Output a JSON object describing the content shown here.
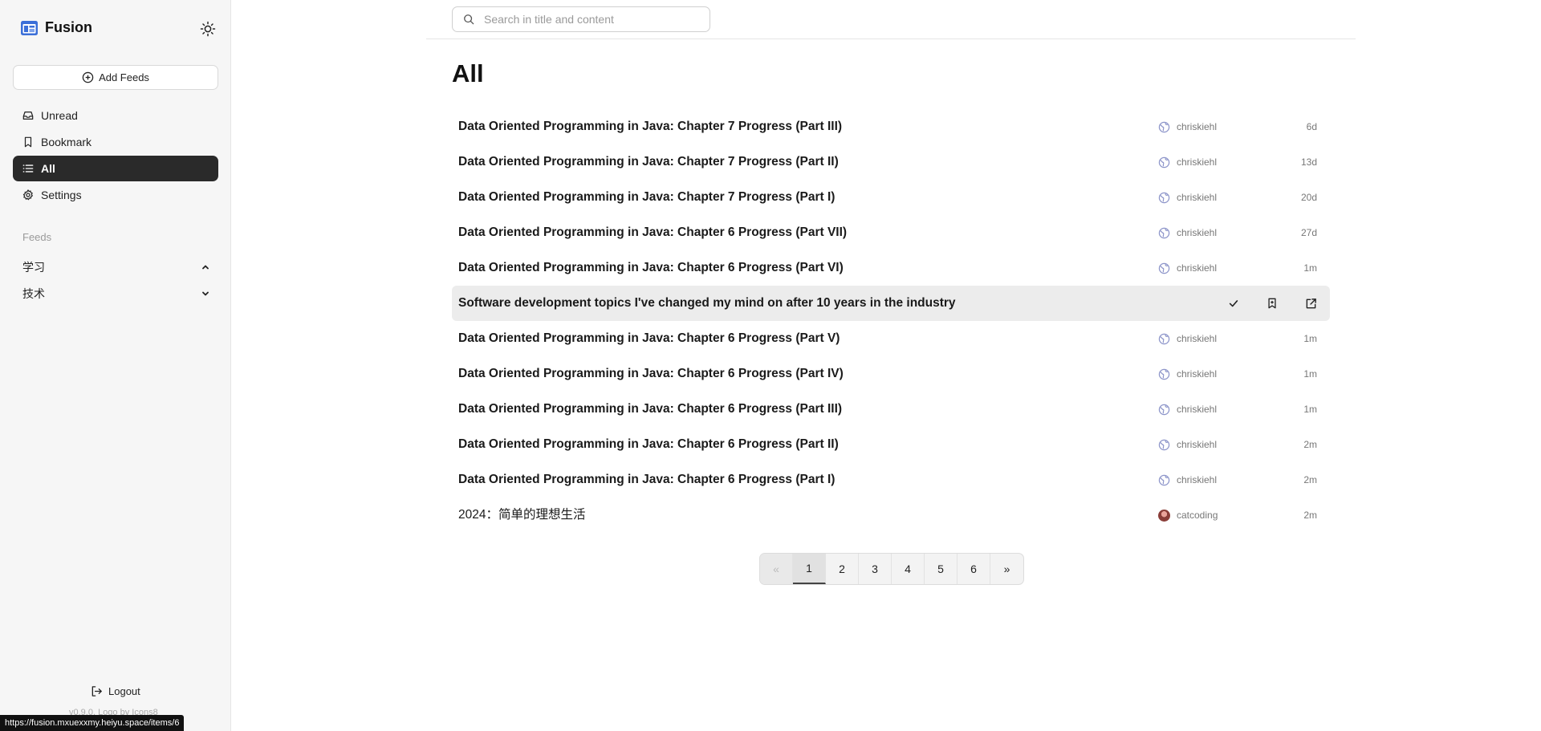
{
  "app": {
    "name": "Fusion"
  },
  "sidebar": {
    "add_feeds_label": "Add Feeds",
    "nav": [
      {
        "label": "Unread",
        "icon": "inbox-icon"
      },
      {
        "label": "Bookmark",
        "icon": "bookmark-icon"
      },
      {
        "label": "All",
        "icon": "list-icon",
        "active": true
      },
      {
        "label": "Settings",
        "icon": "gear-icon"
      }
    ],
    "feeds_label": "Feeds",
    "feed_groups": [
      {
        "label": "学习",
        "expanded": true
      },
      {
        "label": "技术",
        "expanded": false
      }
    ],
    "logout_label": "Logout",
    "version_text": "v0.9.0, Logo by Icons8"
  },
  "status_url": "https://fusion.mxuexxmy.heiyu.space/items/6",
  "search": {
    "placeholder": "Search in title and content",
    "value": ""
  },
  "main": {
    "title": "All",
    "items": [
      {
        "title": "Data Oriented Programming in Java: Chapter 7 Progress (Part III)",
        "source": "chriskiehl",
        "time": "6d"
      },
      {
        "title": "Data Oriented Programming in Java: Chapter 7 Progress (Part II)",
        "source": "chriskiehl",
        "time": "13d"
      },
      {
        "title": "Data Oriented Programming in Java: Chapter 7 Progress (Part I)",
        "source": "chriskiehl",
        "time": "20d"
      },
      {
        "title": "Data Oriented Programming in Java: Chapter 6 Progress (Part VII)",
        "source": "chriskiehl",
        "time": "27d"
      },
      {
        "title": "Data Oriented Programming in Java: Chapter 6 Progress (Part VI)",
        "source": "chriskiehl",
        "time": "1m"
      },
      {
        "title": "Software development topics I've changed my mind on after 10 years in the industry",
        "source": "",
        "time": "",
        "hovered": true
      },
      {
        "title": "Data Oriented Programming in Java: Chapter 6 Progress (Part V)",
        "source": "chriskiehl",
        "time": "1m"
      },
      {
        "title": "Data Oriented Programming in Java: Chapter 6 Progress (Part IV)",
        "source": "chriskiehl",
        "time": "1m"
      },
      {
        "title": "Data Oriented Programming in Java: Chapter 6 Progress (Part III)",
        "source": "chriskiehl",
        "time": "1m"
      },
      {
        "title": "Data Oriented Programming in Java: Chapter 6 Progress (Part II)",
        "source": "chriskiehl",
        "time": "2m"
      },
      {
        "title": "Data Oriented Programming in Java: Chapter 6 Progress (Part I)",
        "source": "chriskiehl",
        "time": "2m"
      },
      {
        "title": "2024：简单的理想生活",
        "source": "catcoding",
        "time": "2m",
        "read": true
      }
    ]
  },
  "pagination": {
    "prev": "«",
    "pages": [
      "1",
      "2",
      "3",
      "4",
      "5",
      "6"
    ],
    "current": "1",
    "next": "»"
  },
  "colors": {
    "brand": "#3b6fd8",
    "active_nav_bg": "#2a2a2a",
    "hover_row_bg": "#ececec"
  }
}
